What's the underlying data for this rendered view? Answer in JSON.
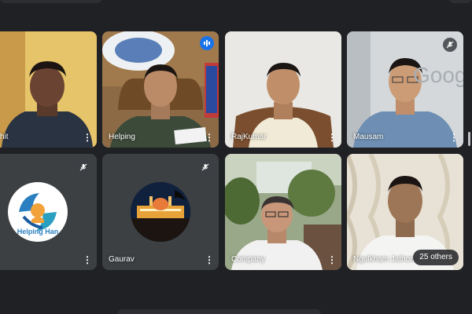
{
  "participants": [
    {
      "name": "hit",
      "muted": false,
      "speaking": false
    },
    {
      "name": "Helping",
      "muted": false,
      "speaking": true
    },
    {
      "name": "RajKumar",
      "muted": false,
      "speaking": false
    },
    {
      "name": "Mausam",
      "muted": true,
      "speaking": false
    },
    {
      "name": "",
      "muted": true,
      "speaking": false
    },
    {
      "name": "Gaurav",
      "muted": true,
      "speaking": false
    },
    {
      "name": "Company",
      "muted": false,
      "speaking": false
    },
    {
      "name": "Ngulkham Jathom",
      "muted": false,
      "speaking": false
    }
  ],
  "others_label": "25 others",
  "logo_text": "Helping Han",
  "background_text": "Goog",
  "more_glyph": "⋮",
  "icons": {
    "mic_off": "mic-off-icon",
    "speaking": "audio-level-icon",
    "more": "more-vert-icon"
  },
  "colors": {
    "background": "#202124",
    "tile": "#3c4043",
    "accent": "#1a73e8",
    "active_border": "#8ab4f8"
  }
}
